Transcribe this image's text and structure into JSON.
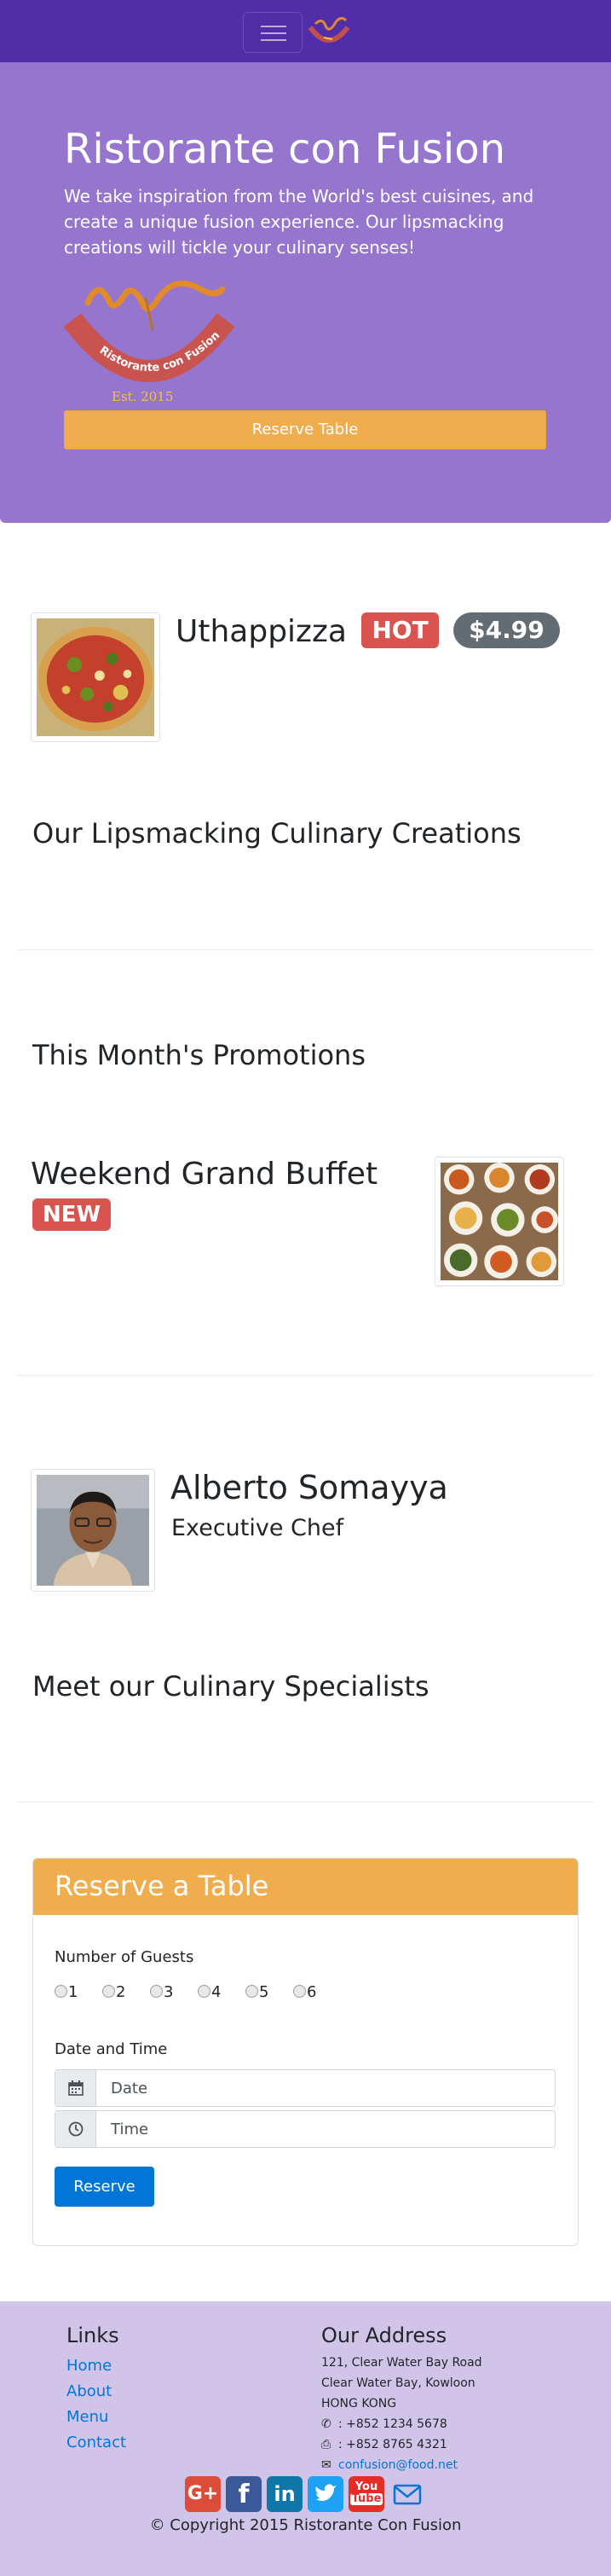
{
  "colors": {
    "primary": "#512DA8",
    "jumbotron": "#9575CD",
    "footer": "#D1C4E9",
    "warning": "#F0AD4E",
    "danger": "#D9534F",
    "secondary": "#636C72",
    "link": "#0275d8"
  },
  "jumbotron": {
    "title": "Ristorante con Fusion",
    "text": "We take inspiration from the World's best cuisines, and create a unique fusion experience. Our lipsmacking creations will tickle your culinary senses!",
    "logo_text": "Ristorante con Fusion",
    "logo_est": "Est. 2015",
    "reserve_label": "Reserve Table"
  },
  "dish": {
    "name": "Uthappizza",
    "badge": "HOT",
    "price": "$4.99"
  },
  "section_dishes": "Our Lipsmacking Culinary Creations",
  "section_promotions": "This Month's Promotions",
  "promotion": {
    "name": "Weekend Grand Buffet",
    "badge": "NEW"
  },
  "leader": {
    "name": "Alberto Somayya",
    "designation": "Executive Chef"
  },
  "section_leaders": "Meet our Culinary Specialists",
  "reserve": {
    "title": "Reserve a Table",
    "guests_label": "Number of Guests",
    "guests": [
      "1",
      "2",
      "3",
      "4",
      "5",
      "6"
    ],
    "datetime_label": "Date and Time",
    "date_placeholder": "Date",
    "time_placeholder": "Time",
    "submit_label": "Reserve"
  },
  "footer": {
    "links_heading": "Links",
    "links": [
      "Home",
      "About",
      "Menu",
      "Contact"
    ],
    "address_heading": "Our Address",
    "address_lines": [
      "121, Clear Water Bay Road",
      "Clear Water Bay, Kowloon",
      "HONG KONG"
    ],
    "phone": ": +852 1234 5678",
    "fax": ": +852 8765 4321",
    "email": "confusion@food.net",
    "social": [
      "google-plus",
      "facebook",
      "linkedin",
      "twitter",
      "youtube",
      "mail"
    ],
    "copyright": "© Copyright 2015 Ristorante Con Fusion"
  }
}
